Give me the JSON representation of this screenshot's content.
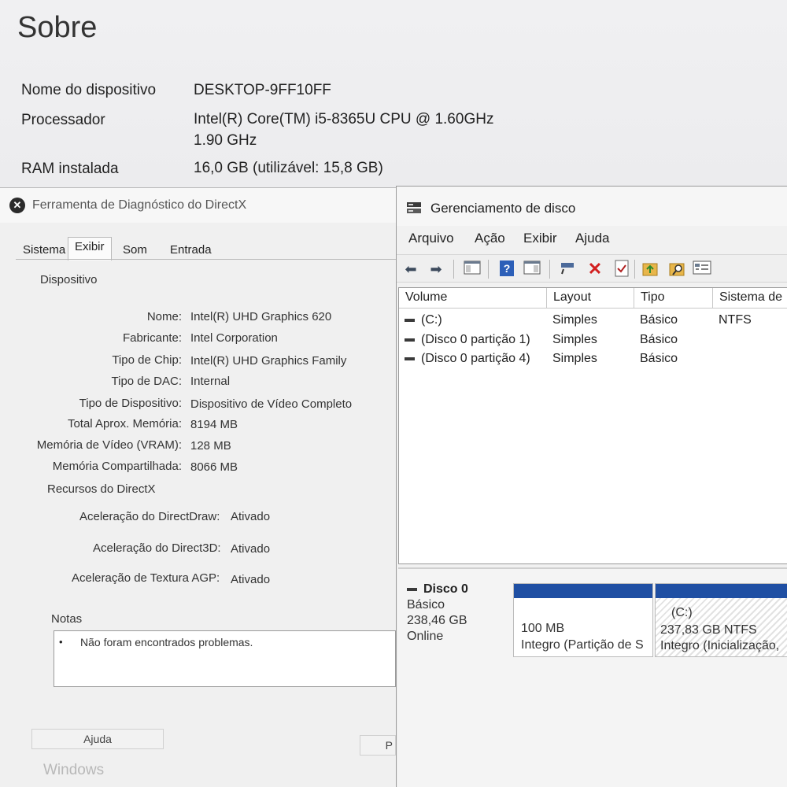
{
  "about": {
    "title": "Sobre",
    "specs": [
      {
        "label": "Nome do dispositivo",
        "value": "DESKTOP-9FF10FF"
      },
      {
        "label": "Processador",
        "value": "Intel(R) Core(TM) i5-8365U CPU @ 1.60GHz",
        "value2": "1.90 GHz"
      },
      {
        "label": "RAM instalada",
        "value": "16,0 GB (utilizável: 15,8 GB)"
      }
    ]
  },
  "dxdiag": {
    "title": "Ferramenta de Diagnóstico do DirectX",
    "tabs": [
      "Sistema",
      "Exibir",
      "Som",
      "Entrada"
    ],
    "active_tab": "Exibir",
    "device_section": "Dispositivo",
    "device": [
      {
        "label": "Nome:",
        "value": "Intel(R) UHD Graphics 620"
      },
      {
        "label": "Fabricante:",
        "value": "Intel Corporation"
      },
      {
        "label": "Tipo de Chip:",
        "value": "Intel(R) UHD Graphics Family"
      },
      {
        "label": "Tipo de DAC:",
        "value": "Internal"
      },
      {
        "label": "Tipo de Dispositivo:",
        "value": "Dispositivo de Vídeo Completo"
      },
      {
        "label": "Total Aprox. Memória:",
        "value": "8194 MB"
      },
      {
        "label": "Memória de Vídeo (VRAM):",
        "value": "128 MB"
      },
      {
        "label": "Memória Compartilhada:",
        "value": "8066 MB"
      }
    ],
    "features_section": "Recursos do DirectX",
    "features": [
      {
        "label": "Aceleração do DirectDraw:",
        "value": "Ativado"
      },
      {
        "label": "Aceleração do Direct3D:",
        "value": "Ativado"
      },
      {
        "label": "Aceleração de Textura AGP:",
        "value": "Ativado"
      }
    ],
    "notes_label": "Notas",
    "notes": [
      "Não foram encontrados problemas."
    ],
    "help_button": "Ajuda",
    "next_button": "P",
    "watermark": "Windows"
  },
  "diskmgmt": {
    "title": "Gerenciamento de disco",
    "menu": [
      "Arquivo",
      "Ação",
      "Exibir",
      "Ajuda"
    ],
    "toolbar_icons": [
      "back-arrow-icon",
      "forward-arrow-icon",
      "console-tree-icon",
      "help-icon",
      "action-pane-icon",
      "connect-icon",
      "delete-icon",
      "properties-icon",
      "up-level-icon",
      "search-icon",
      "list-view-icon"
    ],
    "columns": [
      "Volume",
      "Layout",
      "Tipo",
      "Sistema de"
    ],
    "volumes": [
      {
        "volume": "(C:)",
        "layout": "Simples",
        "type": "Básico",
        "fs": "NTFS"
      },
      {
        "volume": "(Disco 0 partição 1)",
        "layout": "Simples",
        "type": "Básico",
        "fs": ""
      },
      {
        "volume": "(Disco 0 partição 4)",
        "layout": "Simples",
        "type": "Básico",
        "fs": ""
      }
    ],
    "disk": {
      "name": "Disco 0",
      "type": "Básico",
      "size": "238,46 GB",
      "status": "Online",
      "partitions": [
        {
          "title": "",
          "size": "100 MB",
          "status": "Integro (Partição de S"
        },
        {
          "title": "(C:)",
          "size": "237,83 GB NTFS",
          "status": "Integro (Inicialização,"
        }
      ]
    },
    "colors": {
      "partition_bar": "#1f4fa3"
    }
  }
}
